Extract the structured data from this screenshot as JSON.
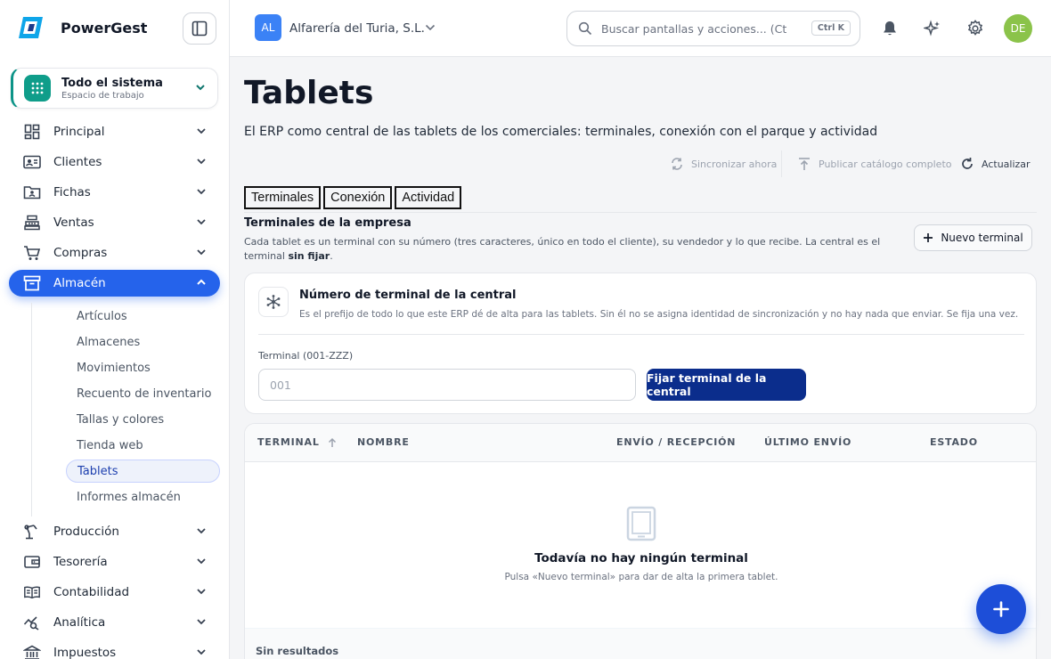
{
  "brand": {
    "name": "PowerGest"
  },
  "workspace": {
    "title": "Todo el sistema",
    "subtitle": "Espacio de trabajo"
  },
  "sidebar": {
    "items": [
      {
        "label": "Principal",
        "icon": "grid-icon"
      },
      {
        "label": "Clientes",
        "icon": "contact-card-icon"
      },
      {
        "label": "Fichas",
        "icon": "folder-user-icon"
      },
      {
        "label": "Ventas",
        "icon": "cash-register-icon"
      },
      {
        "label": "Compras",
        "icon": "cart-icon"
      },
      {
        "label": "Almacén",
        "icon": "archive-box-icon",
        "active": true
      },
      {
        "label": "Producción",
        "icon": "factory-arm-icon"
      },
      {
        "label": "Tesorería",
        "icon": "wallet-icon"
      },
      {
        "label": "Contabilidad",
        "icon": "ledger-book-icon"
      },
      {
        "label": "Analítica",
        "icon": "analytics-icon"
      },
      {
        "label": "Impuestos",
        "icon": "institution-icon"
      }
    ],
    "subitems": [
      "Artículos",
      "Almacenes",
      "Movimientos",
      "Recuento de inventario",
      "Tallas y colores",
      "Tienda web",
      "Tablets",
      "Informes almacén"
    ],
    "active_subitem": "Tablets"
  },
  "topbar": {
    "company_initials": "AL",
    "company_name": "Alfarería del Turia, S.L.",
    "search_placeholder": "Buscar pantallas y acciones... (Ctrl+K)",
    "search_shortcut": "Ctrl K",
    "user_initials": "DE"
  },
  "page": {
    "title": "Tablets",
    "subtitle": "El ERP como central de las tablets de los comerciales: terminales, conexión con el parque y actividad",
    "actions": {
      "sync": "Sincronizar ahora",
      "publish": "Publicar catálogo completo",
      "refresh": "Actualizar"
    },
    "tabs": [
      "Terminales",
      "Conexión",
      "Actividad"
    ]
  },
  "section": {
    "title": "Terminales de la empresa",
    "description": "Cada tablet es un terminal con su número (tres caracteres, único en todo el cliente), su vendedor y lo que recibe. La central es el terminal",
    "description_bold": "sin fijar",
    "description_end": ".",
    "new_button": "Nuevo terminal"
  },
  "central": {
    "title": "Número de terminal de la central",
    "description": "Es el prefijo de todo lo que este ERP dé de alta para las tablets. Sin él no se asigna identidad de sincronización y no hay nada que enviar. Se fija una vez.",
    "field_label": "Terminal (001-ZZZ)",
    "field_placeholder": "001",
    "button": "Fijar terminal de la central"
  },
  "table": {
    "columns": [
      "TERMINAL",
      "NOMBRE",
      "ENVÍO / RECEPCIÓN",
      "ÚLTIMO ENVÍO",
      "ESTADO"
    ],
    "empty_title": "Todavía no hay ningún terminal",
    "empty_subtitle": "Pulsa «Nuevo terminal» para dar de alta la primera tablet.",
    "footer": "Sin resultados"
  },
  "colors": {
    "accent": "#2563eb",
    "primary_dark": "#0b2d8c",
    "teal": "#0f9d8a",
    "avatar": "#8bc34a"
  }
}
